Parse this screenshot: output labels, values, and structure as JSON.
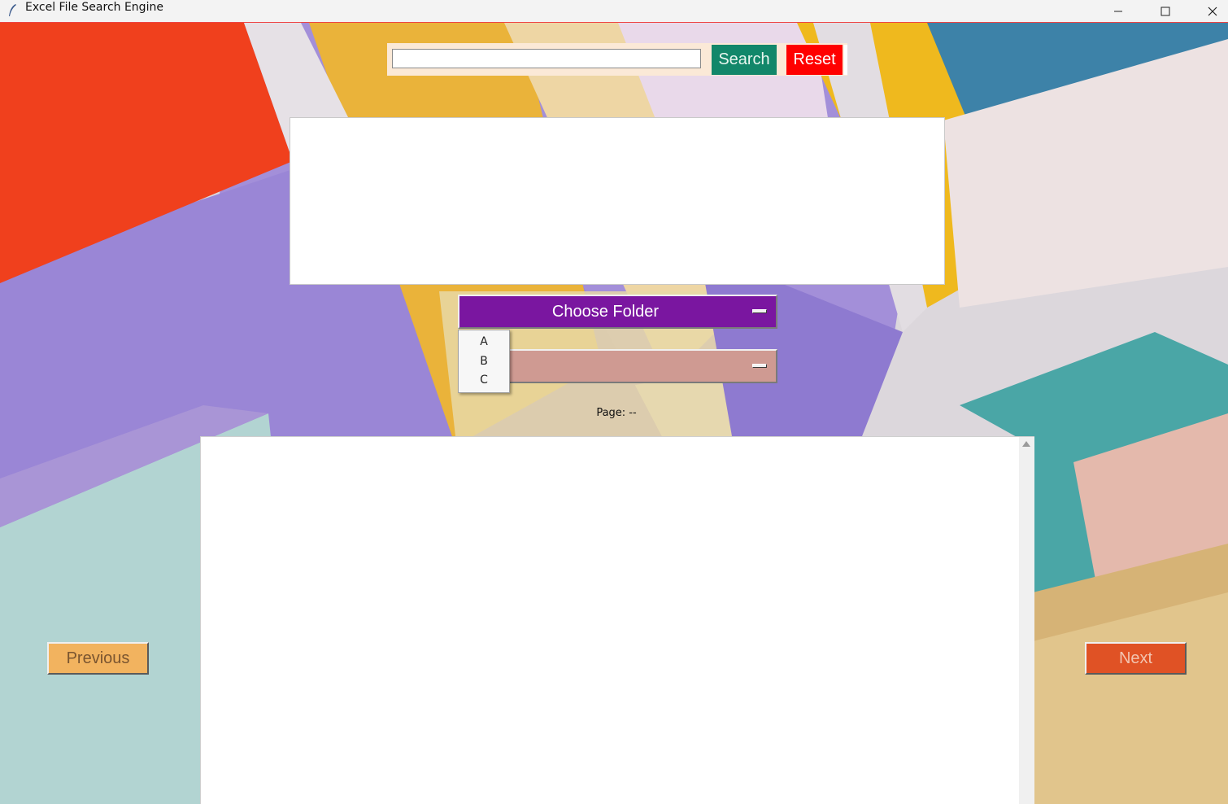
{
  "window": {
    "title": "Excel File Search Engine"
  },
  "search": {
    "value": "",
    "placeholder": "",
    "search_label": "Search",
    "reset_label": "Reset"
  },
  "folder_menu": {
    "label": "Choose Folder",
    "options": [
      "A",
      "B",
      "C"
    ]
  },
  "file_menu": {
    "label": ""
  },
  "pagination": {
    "page_text": "Page: --",
    "previous_label": "Previous",
    "next_label": "Next"
  },
  "colors": {
    "search_button": "#12876a",
    "reset_button": "#ff0000",
    "folder_menu": "#7a16a0",
    "file_menu": "#cf9a92",
    "previous_button": "#f2b35f",
    "next_button": "#e05225"
  }
}
